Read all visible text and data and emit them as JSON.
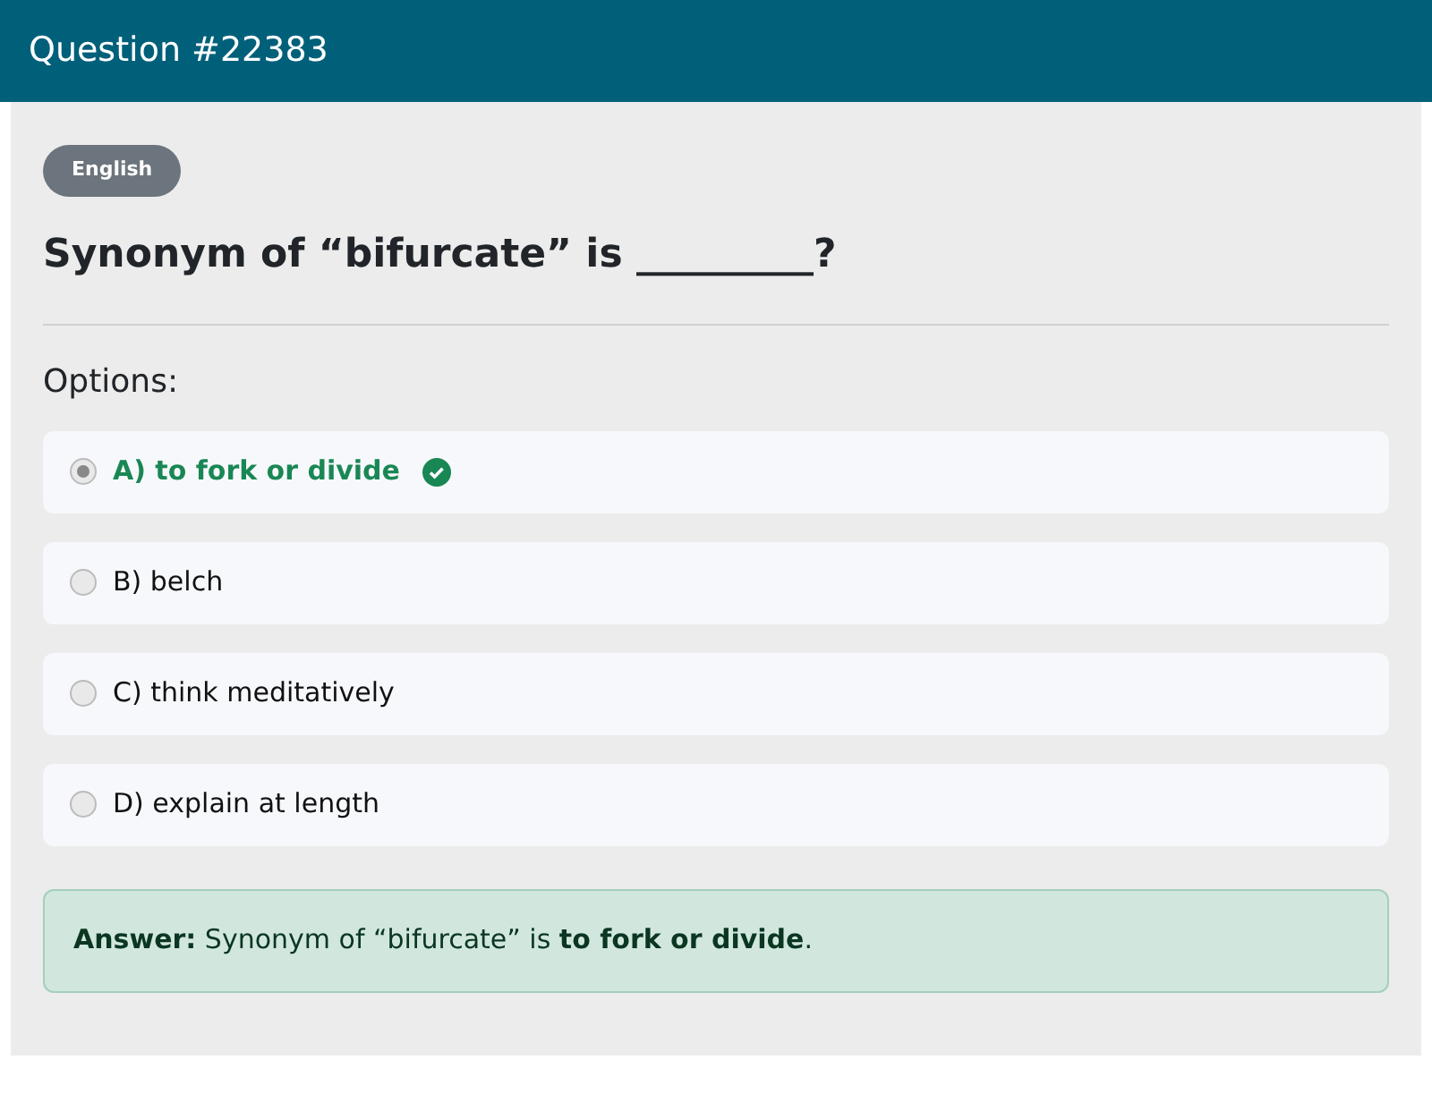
{
  "header": {
    "title": "Question #22383"
  },
  "badge": "English",
  "question": "Synonym of “bifurcate” is _________?",
  "options_label": "Options:",
  "options": [
    {
      "label": "A) to fork or divide",
      "selected": true,
      "correct": true
    },
    {
      "label": "B) belch",
      "selected": false,
      "correct": false
    },
    {
      "label": "C) think meditatively",
      "selected": false,
      "correct": false
    },
    {
      "label": "D) explain at length",
      "selected": false,
      "correct": false
    }
  ],
  "answer": "**Answer:** Synonym of “bifurcate” is **to fork or divide**."
}
